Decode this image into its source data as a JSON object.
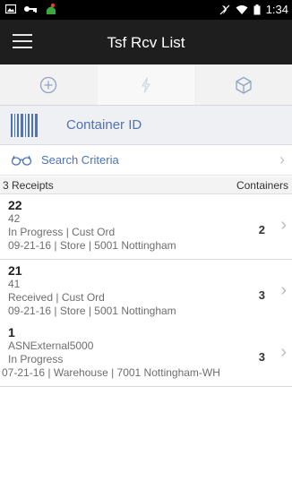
{
  "status_bar": {
    "time": "1:34"
  },
  "app_bar": {
    "title": "Tsf Rcv List"
  },
  "tabs": [
    {
      "icon": "plus-circle-icon"
    },
    {
      "icon": "lightning-icon"
    },
    {
      "icon": "cube-icon"
    }
  ],
  "container": {
    "label": "Container ID"
  },
  "search": {
    "label": "Search Criteria"
  },
  "summary": {
    "receipts": "3 Receipts",
    "containers": "Containers"
  },
  "receipts": [
    {
      "id": "22",
      "ref": "42",
      "status": "In Progress | Cust Ord",
      "detail": "09-21-16  |  Store  |  5001 Nottingham",
      "containers": "2"
    },
    {
      "id": "21",
      "ref": "41",
      "status": "Received | Cust Ord",
      "detail": "09-21-16  |  Store  |  5001 Nottingham",
      "containers": "3"
    },
    {
      "id": "1",
      "ref": "ASNExternal5000",
      "status": "In Progress",
      "detail": "07-21-16 | Warehouse | 7001 Nottingham-WH",
      "containers": "3"
    }
  ],
  "colors": {
    "accent": "#4d73b8",
    "appbar": "#1e1e1e",
    "statusbar": "#000000"
  }
}
